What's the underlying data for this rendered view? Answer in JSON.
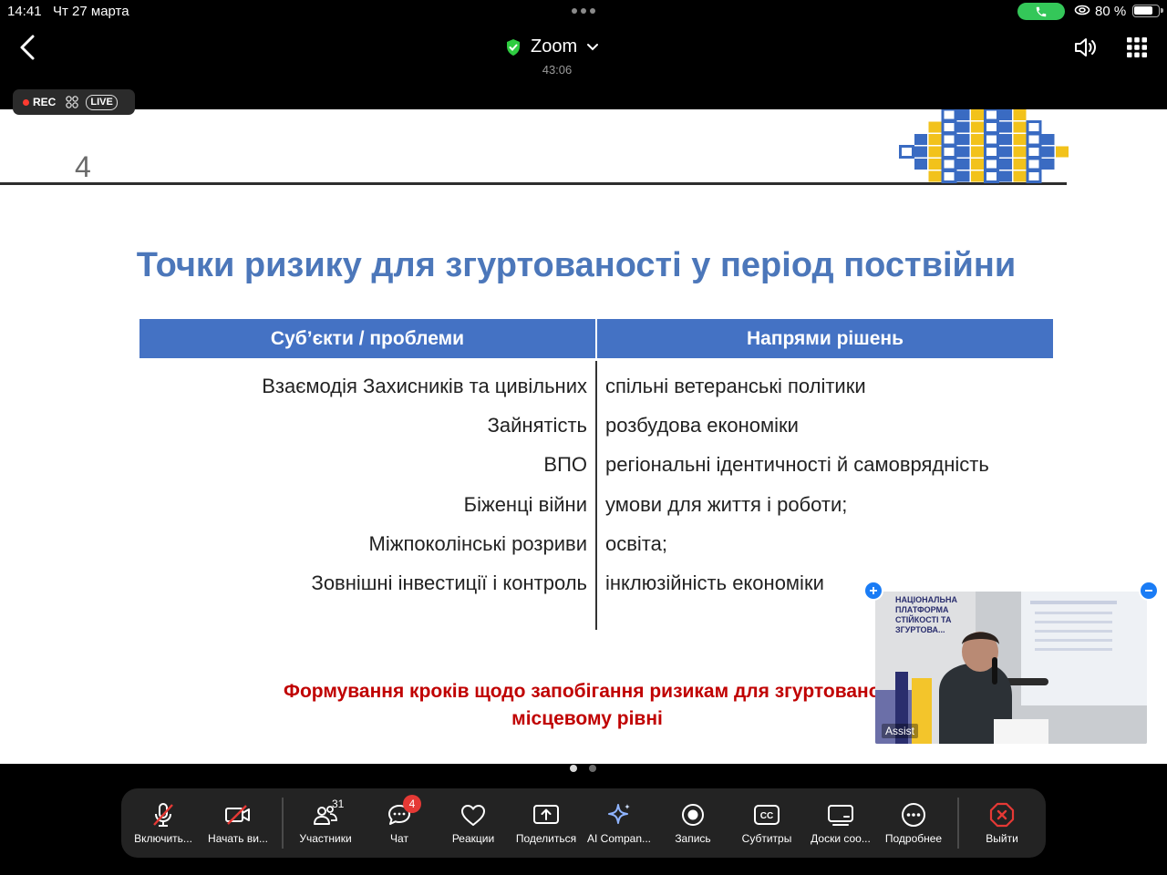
{
  "status_bar": {
    "time": "14:41",
    "date": "Чт 27 марта",
    "battery": "80 %",
    "battery_level_pct": 80
  },
  "header": {
    "app_title": "Zoom",
    "elapsed": "43:06"
  },
  "recording": {
    "rec_label": "REC",
    "live_label": "LIVE"
  },
  "slide": {
    "number": "4",
    "title": "Точки ризику для згуртованості у період поствійни",
    "col_left_header": "Суб’єкти / проблеми",
    "col_right_header": "Напрями рішень",
    "left_items": [
      "Взаємодія Захисників та цивільних",
      "Зайнятість",
      "ВПО",
      "Біженці війни",
      "Міжпоколінські розриви",
      "Зовнішні інвестиції і контроль"
    ],
    "right_items": [
      "спільні ветеранські політики",
      "розбудова економіки",
      "регіональні ідентичності й  самоврядність",
      "умови для життя і роботи;",
      "освіта;",
      "інклюзійність економіки"
    ],
    "footer_line1": "Формування кроків щодо запобігання ризикам для згуртованос",
    "footer_line2": "місцевому рівні"
  },
  "video_tile": {
    "name": "Assist",
    "poster_text": "НАЦІОНАЛЬНА ПЛАТФОРМА СТІЙКОСТІ ТА ЗГУРТОВА..."
  },
  "toolbar": {
    "items": [
      {
        "label": "Включить...",
        "icon": "mic-off-icon"
      },
      {
        "label": "Начать ви...",
        "icon": "video-off-icon"
      },
      {
        "label": "Участники",
        "icon": "participants-icon",
        "count": "31"
      },
      {
        "label": "Чат",
        "icon": "chat-icon",
        "badge": "4"
      },
      {
        "label": "Реакции",
        "icon": "heart-icon"
      },
      {
        "label": "Поделиться",
        "icon": "share-icon"
      },
      {
        "label": "AI Compan...",
        "icon": "sparkle-icon"
      },
      {
        "label": "Запись",
        "icon": "record-icon"
      },
      {
        "label": "Субтитры",
        "icon": "cc-icon"
      },
      {
        "label": "Доски соо...",
        "icon": "whiteboard-icon"
      },
      {
        "label": "Подробнее",
        "icon": "more-icon"
      },
      {
        "label": "Выйти",
        "icon": "leave-icon"
      }
    ]
  },
  "colors": {
    "slide_title": "#4c77ba",
    "table_header": "#4472c4",
    "footer_red": "#c00000",
    "call_green": "#34c759",
    "rec_red": "#ff3b30",
    "leave_red": "#e53935",
    "zoom_blue": "#1a7cf5"
  }
}
